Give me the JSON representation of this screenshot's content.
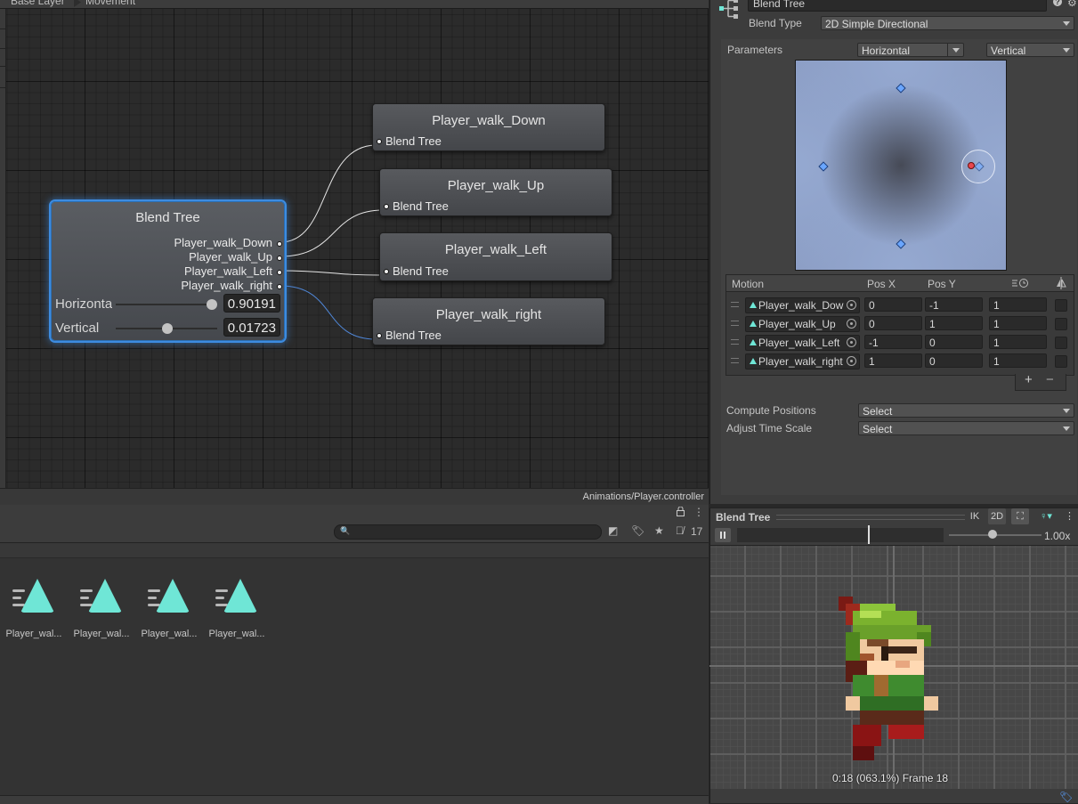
{
  "graph": {
    "breadcrumb": [
      "Base Layer",
      "Movement"
    ],
    "status_path": "Animations/Player.controller",
    "blend_tree_node": {
      "title": "Blend Tree",
      "outputs": [
        "Player_walk_Down",
        "Player_walk_Up",
        "Player_walk_Left",
        "Player_walk_right"
      ],
      "params": [
        {
          "name": "Horizontal",
          "value": "0.90191",
          "level": 0.95
        },
        {
          "name": "Vertical",
          "value": "0.01723",
          "level": 0.51
        }
      ]
    },
    "clip_nodes": [
      {
        "title": "Player_walk_Down",
        "port": "Blend Tree"
      },
      {
        "title": "Player_walk_Up",
        "port": "Blend Tree"
      },
      {
        "title": "Player_walk_Left",
        "port": "Blend Tree"
      },
      {
        "title": "Player_walk_right",
        "port": "Blend Tree"
      }
    ]
  },
  "inspector": {
    "name": "Blend Tree",
    "blend_type_label": "Blend Type",
    "blend_type": "2D Simple Directional",
    "parameters_label": "Parameters",
    "param_x": "Horizontal",
    "param_y": "Vertical",
    "motion_table": {
      "headers": [
        "Motion",
        "Pos X",
        "Pos Y"
      ],
      "rows": [
        {
          "clip": "Player_walk_Down",
          "pos_x": "0",
          "pos_y": "-1",
          "speed": "1"
        },
        {
          "clip": "Player_walk_Up",
          "pos_x": "0",
          "pos_y": "1",
          "speed": "1"
        },
        {
          "clip": "Player_walk_Left",
          "pos_x": "-1",
          "pos_y": "0",
          "speed": "1"
        },
        {
          "clip": "Player_walk_right",
          "pos_x": "1",
          "pos_y": "0",
          "speed": "1"
        }
      ],
      "add": "+",
      "remove": "−"
    },
    "compute_positions_label": "Compute Positions",
    "compute_positions_value": "Select",
    "adjust_time_scale_label": "Adjust Time Scale",
    "adjust_time_scale_value": "Select"
  },
  "project": {
    "hidden_count": "17",
    "assets": [
      "Player_wal...",
      "Player_wal...",
      "Player_wal...",
      "Player_wal..."
    ]
  },
  "preview": {
    "title": "Blend Tree",
    "ik_label": "IK",
    "mode_2d_label": "2D",
    "speed": "1.00x",
    "frame_info": "0:18 (063.1%) Frame 18"
  },
  "colors": {
    "selection_blue": "#3d8ce0",
    "clip_teal": "#6fe6d6",
    "node_gray": "#4f5156"
  }
}
